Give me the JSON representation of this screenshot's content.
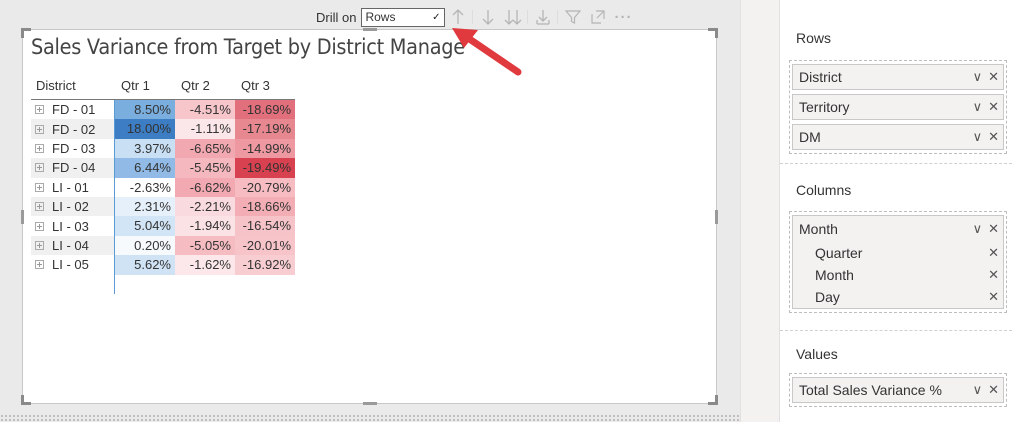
{
  "visual": {
    "title": "Sales Variance from Target by District Manage"
  },
  "toolbar": {
    "drill_on_label": "Drill on",
    "drill_select_value": "Rows",
    "icons": [
      "drill-up-icon",
      "drill-down-icon",
      "expand-all-down-icon",
      "expand-next-level-icon",
      "filter-icon",
      "focus-mode-icon",
      "more-options-icon"
    ]
  },
  "matrix": {
    "headers": [
      "District",
      "Qtr 1",
      "Qtr 2",
      "Qtr 3"
    ],
    "rows": [
      {
        "district": "FD - 01",
        "q1": "8.50%",
        "q2": "-4.51%",
        "q3": "-18.69%"
      },
      {
        "district": "FD - 02",
        "q1": "18.00%",
        "q2": "-1.11%",
        "q3": "-17.19%"
      },
      {
        "district": "FD - 03",
        "q1": "3.97%",
        "q2": "-6.65%",
        "q3": "-14.99%"
      },
      {
        "district": "FD - 04",
        "q1": "6.44%",
        "q2": "-5.45%",
        "q3": "-19.49%"
      },
      {
        "district": "LI - 01",
        "q1": "-2.63%",
        "q2": "-6.62%",
        "q3": "-20.79%"
      },
      {
        "district": "LI - 02",
        "q1": "2.31%",
        "q2": "-2.21%",
        "q3": "-18.66%"
      },
      {
        "district": "LI - 03",
        "q1": "5.04%",
        "q2": "-1.94%",
        "q3": "-16.54%"
      },
      {
        "district": "LI - 04",
        "q1": "0.20%",
        "q2": "-5.05%",
        "q3": "-20.01%"
      },
      {
        "district": "LI - 05",
        "q1": "5.62%",
        "q2": "-1.62%",
        "q3": "-16.92%"
      }
    ],
    "colors": {
      "q1": [
        "#7aaede",
        "#3c7dc4",
        "#c8dff4",
        "#91bbe6",
        "#ffffff",
        "#e6f0fa",
        "#d2e5f6",
        "#f7fafd",
        "#cfe3f5"
      ],
      "q2": [
        "#f6c6cb",
        "#fbe7e9",
        "#f2a8b0",
        "#f4b8be",
        "#f2a9b1",
        "#f9dade",
        "#fbe2e5",
        "#f5bcc2",
        "#fce8ea"
      ],
      "q3": [
        "#e2707c",
        "#e7878f",
        "#ee99a1",
        "#d8414f",
        "#f6bcc2",
        "#f3aeb5",
        "#f5c3c8",
        "#f7c4c9",
        "#f7cdd1"
      ]
    }
  },
  "panel": {
    "rows_label": "Rows",
    "rows_fields": [
      "District",
      "Territory",
      "DM"
    ],
    "columns_label": "Columns",
    "columns_hierarchy": "Month",
    "columns_levels": [
      "Quarter",
      "Month",
      "Day"
    ],
    "values_label": "Values",
    "values_fields": [
      "Total Sales Variance %"
    ]
  }
}
